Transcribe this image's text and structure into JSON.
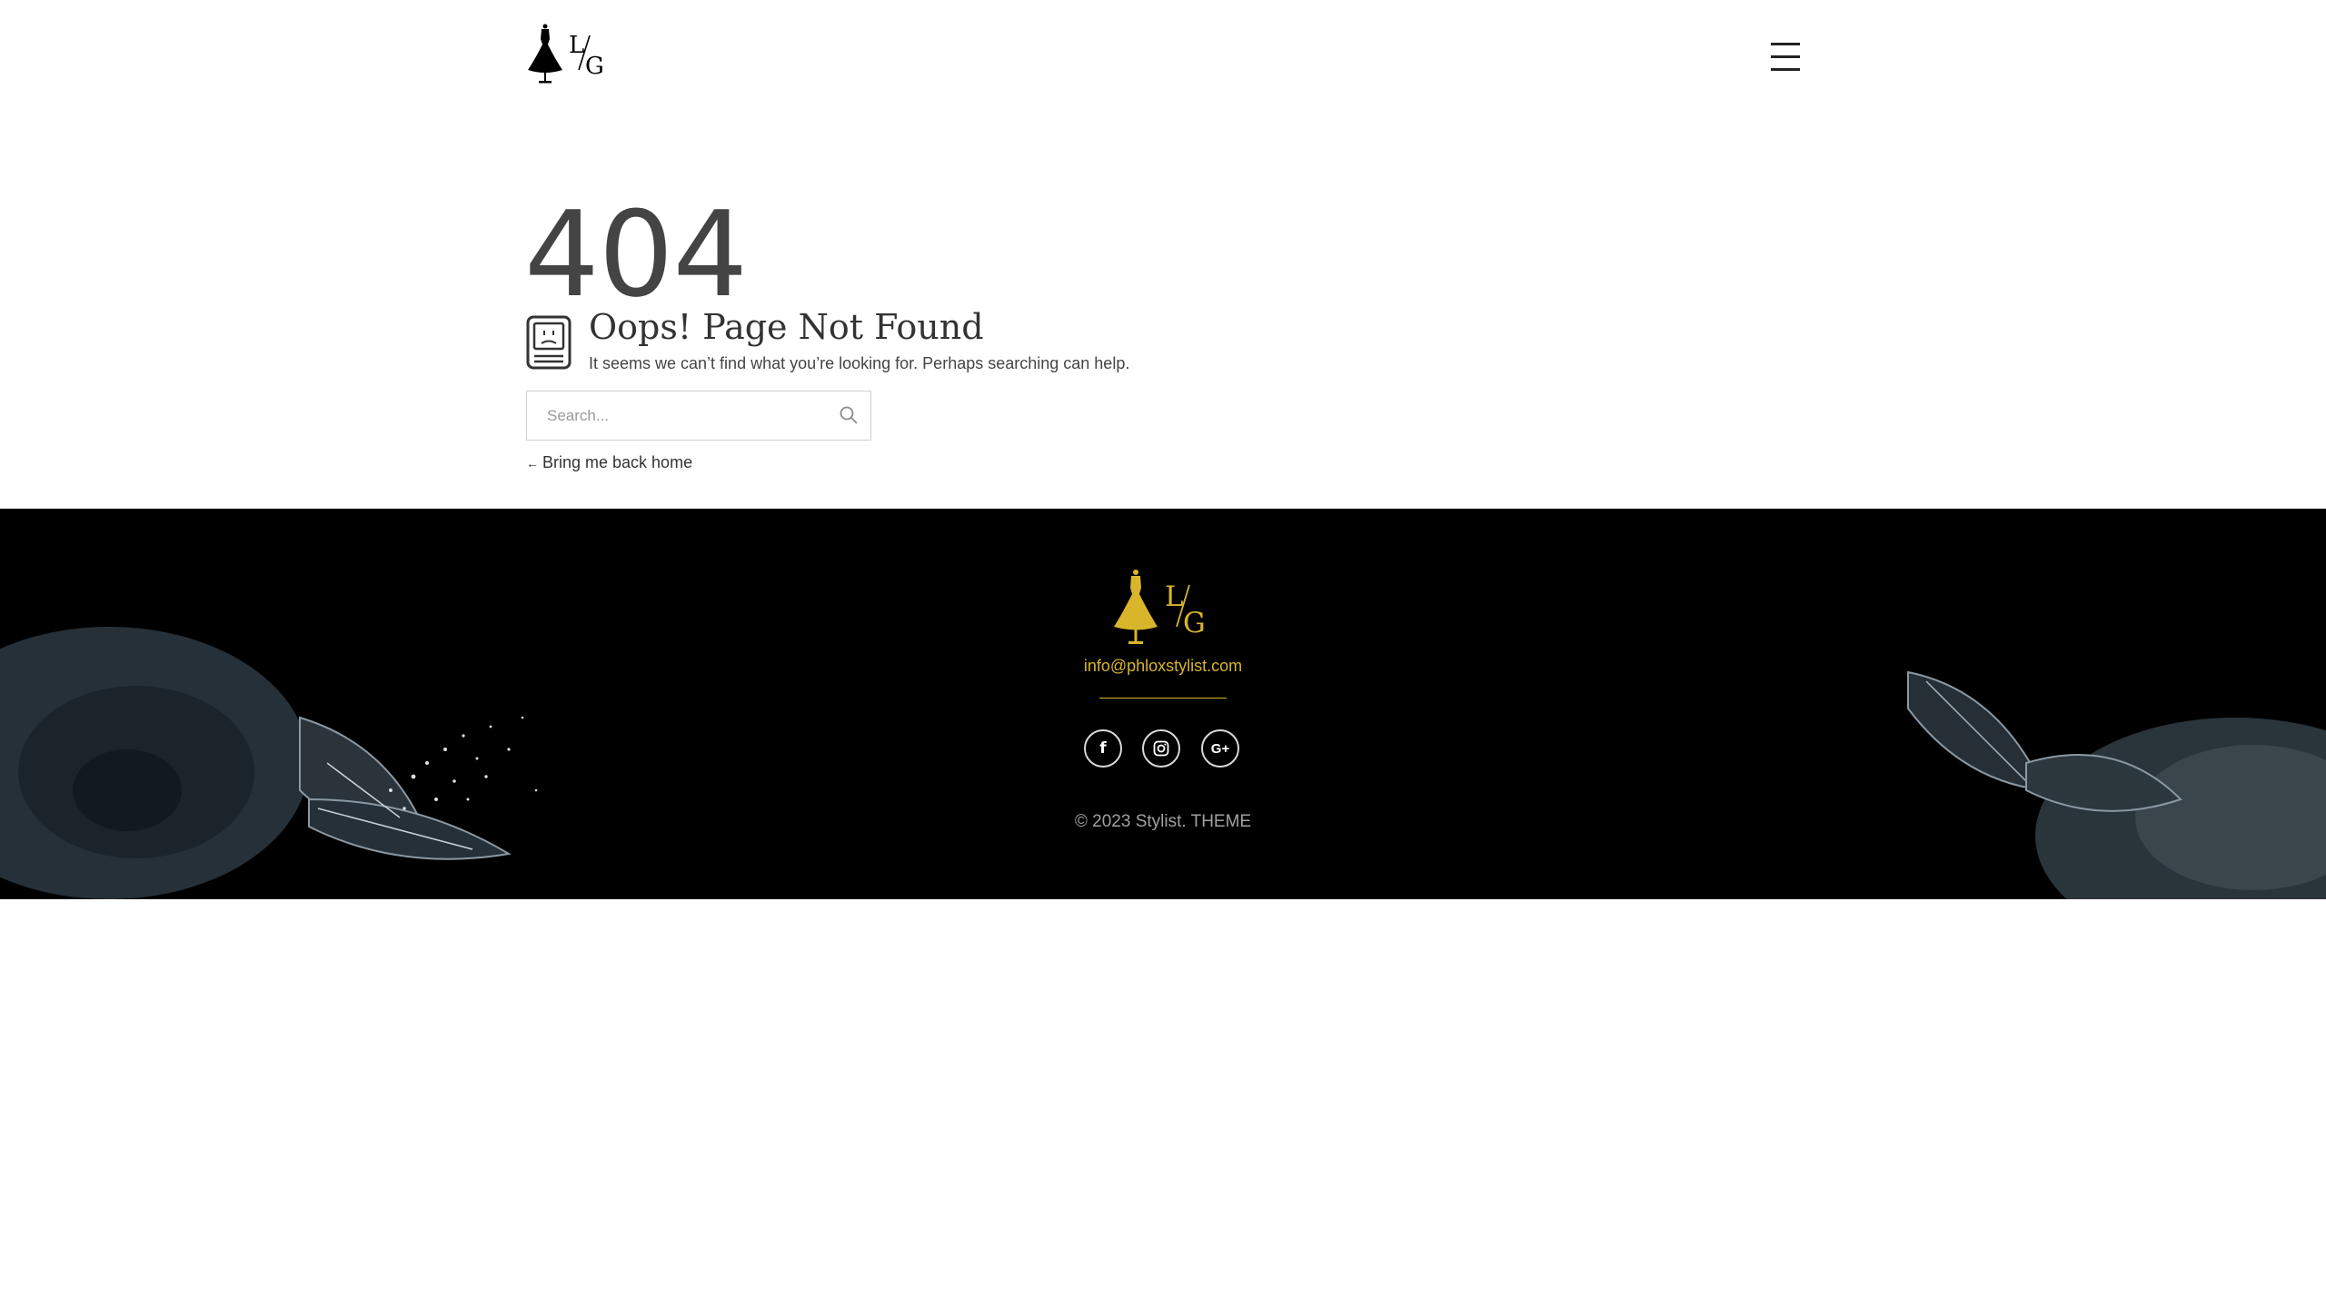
{
  "header": {
    "logo_alt": "L/G",
    "menu_label": "menu"
  },
  "error": {
    "code": "404",
    "title": "Oops! Page Not Found",
    "message": "It seems we can’t find what you’re looking for. Perhaps searching can help."
  },
  "search": {
    "placeholder": "Search...",
    "value": "",
    "button_icon": "search-icon"
  },
  "back_link": {
    "arrow": "←",
    "label": "Bring me back home"
  },
  "footer": {
    "email": "info@phloxstylist.com",
    "socials": [
      {
        "icon": "facebook-icon",
        "glyph": "f"
      },
      {
        "icon": "instagram-icon",
        "glyph": ""
      },
      {
        "icon": "google-plus-icon",
        "glyph": "G+"
      }
    ],
    "copyright": "© 2023 Stylist. THEME"
  },
  "colors": {
    "accent": "#d8b52a",
    "footer_bg": "#000000",
    "text": "#333333"
  }
}
